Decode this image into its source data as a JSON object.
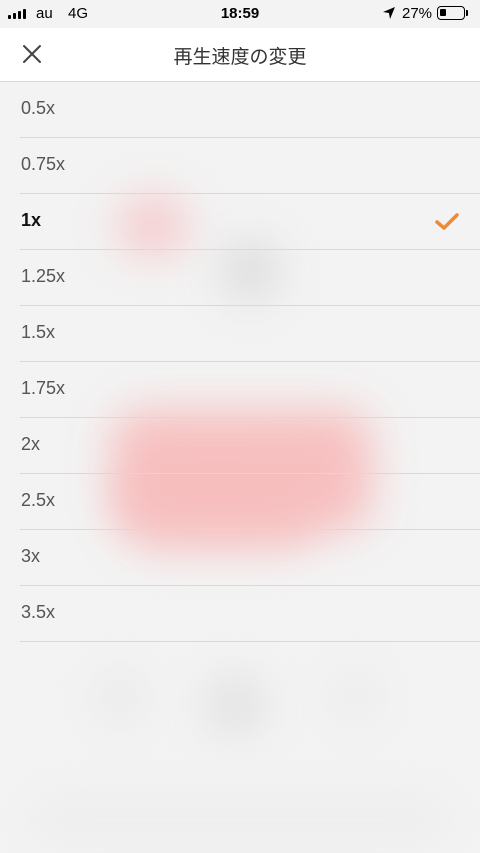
{
  "status_bar": {
    "carrier": "au",
    "network": "4G",
    "time": "18:59",
    "battery_percent": "27%",
    "battery_level": 0.27,
    "signal_bars": 4
  },
  "header": {
    "title": "再生速度の変更",
    "close_icon": "close-x-icon"
  },
  "speed_options": [
    {
      "label": "0.5x",
      "selected": false
    },
    {
      "label": "0.75x",
      "selected": false
    },
    {
      "label": "1x",
      "selected": true
    },
    {
      "label": "1.25x",
      "selected": false
    },
    {
      "label": "1.5x",
      "selected": false
    },
    {
      "label": "1.75x",
      "selected": false
    },
    {
      "label": "2x",
      "selected": false
    },
    {
      "label": "2.5x",
      "selected": false
    },
    {
      "label": "3x",
      "selected": false
    },
    {
      "label": "3.5x",
      "selected": false
    }
  ],
  "colors": {
    "accent": "#f08a32",
    "background": "#f3f3f3"
  },
  "icons": {
    "selected_marker": "checkmark-icon"
  }
}
